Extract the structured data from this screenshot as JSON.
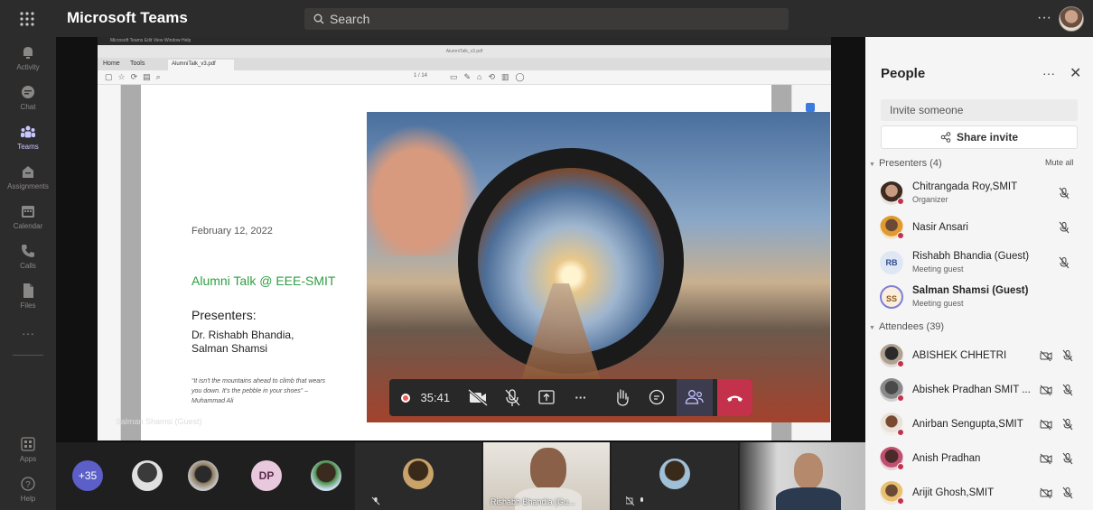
{
  "app": {
    "title": "Microsoft Teams",
    "search_placeholder": "Search",
    "more": "···"
  },
  "rail": [
    {
      "label": "Activity",
      "icon": "bell-icon"
    },
    {
      "label": "Chat",
      "icon": "chat-icon"
    },
    {
      "label": "Teams",
      "icon": "teams-icon",
      "active": true
    },
    {
      "label": "Assignments",
      "icon": "assignments-icon"
    },
    {
      "label": "Calendar",
      "icon": "calendar-icon"
    },
    {
      "label": "Calls",
      "icon": "phone-icon"
    },
    {
      "label": "Files",
      "icon": "file-icon"
    },
    {
      "label": "···",
      "icon": "more-icon"
    },
    {
      "label": "Apps",
      "icon": "apps-icon"
    },
    {
      "label": "Help",
      "icon": "help-icon"
    }
  ],
  "shared_screen": {
    "menubar": "Microsoft Teams   Edit   View   Window   Help",
    "window_title": "AlumniTalk_v3.pdf",
    "tabs": {
      "home": "Home",
      "tools": "Tools",
      "doc": "AlumniTalk_v3.pdf"
    },
    "page_indicator": "1 / 14",
    "slide": {
      "date": "February 12, 2022",
      "title": "Alumni Talk @ EEE-SMIT",
      "presenters_heading": "Presenters:",
      "presenters_names": "Dr. Rishabh Bhandia,\nSalman Shamsi",
      "quote": "“It isn't the mountains ahead to climb that wears you down. It's the pebble in your shoes” – Muhammad Ali"
    }
  },
  "call_controls": {
    "timer": "35:41",
    "more": "···"
  },
  "presenter_label": "Salman Shamsi (Guest)",
  "strip": {
    "overflow": "+35",
    "dp_initials": "DP",
    "tile_label": "Rishabh Bhandia (Gu..."
  },
  "people_panel": {
    "title": "People",
    "more": "···",
    "close": "✕",
    "invite_placeholder": "Invite someone",
    "share_invite": "Share invite",
    "presenters_heading": "Presenters (4)",
    "mute_all": "Mute all",
    "attendees_heading": "Attendees (39)",
    "presenters": [
      {
        "name": "Chitrangada Roy,SMIT",
        "role": "Organizer"
      },
      {
        "name": "Nasir Ansari",
        "role": ""
      },
      {
        "name": "Rishabh Bhandia (Guest)",
        "role": "Meeting guest",
        "initials": "RB"
      },
      {
        "name": "Salman Shamsi (Guest)",
        "role": "Meeting guest",
        "initials": "SS"
      }
    ],
    "attendees": [
      {
        "name": "ABISHEK CHHETRI"
      },
      {
        "name": "Abishek Pradhan SMIT ..."
      },
      {
        "name": "Anirban Sengupta,SMIT"
      },
      {
        "name": "Anish Pradhan"
      },
      {
        "name": "Arijit Ghosh,SMIT"
      }
    ]
  }
}
